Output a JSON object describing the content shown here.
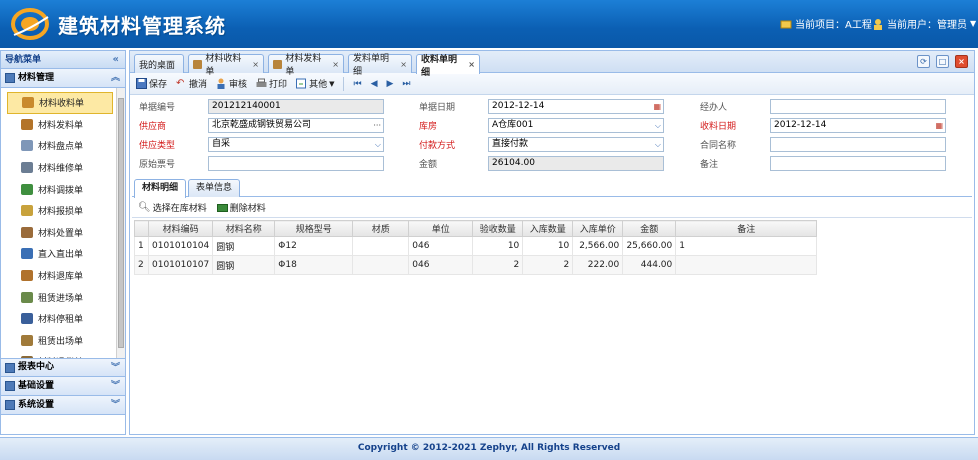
{
  "header": {
    "title": "建筑材料管理系统",
    "project": "当前项目：A工程",
    "user": "当前用户：管理员"
  },
  "sidebar": {
    "title": "导航菜单",
    "groups": [
      {
        "label": "材料管理"
      },
      {
        "label": "报表中心"
      },
      {
        "label": "基础设置"
      },
      {
        "label": "系统设置"
      }
    ],
    "items": [
      {
        "label": "材料收料单",
        "color": "#c98a2c"
      },
      {
        "label": "材料发料单",
        "color": "#b3742a"
      },
      {
        "label": "材料盘点单",
        "color": "#7f97b8"
      },
      {
        "label": "材料维修单",
        "color": "#6b7d93"
      },
      {
        "label": "材料调拨单",
        "color": "#3f8f3f"
      },
      {
        "label": "材料报损单",
        "color": "#c8a23c"
      },
      {
        "label": "材料处置单",
        "color": "#9a6b3a"
      },
      {
        "label": "直入直出单",
        "color": "#3a6fb5"
      },
      {
        "label": "材料退库单",
        "color": "#b0722c"
      },
      {
        "label": "租赁进场单",
        "color": "#6a8a4a"
      },
      {
        "label": "材料停租单",
        "color": "#3a5f9a"
      },
      {
        "label": "租赁出场单",
        "color": "#a07a3a"
      },
      {
        "label": "材料退货单",
        "color": "#8a6a3a"
      }
    ]
  },
  "tabs": [
    {
      "label": "我的桌面"
    },
    {
      "label": "材料收料单"
    },
    {
      "label": "材料发料单"
    },
    {
      "label": "发料单明细"
    },
    {
      "label": "收料单明细"
    }
  ],
  "toolbar": {
    "save": "保存",
    "undo": "撤消",
    "audit": "审核",
    "print": "打印",
    "other": "其他"
  },
  "form": {
    "doc_no_label": "单据编号",
    "doc_no": "201212140001",
    "doc_date_label": "单据日期",
    "doc_date": "2012-12-14",
    "handler_label": "经办人",
    "handler": "",
    "supplier_label": "供应商",
    "supplier": "北京乾盛成钢铁贸易公司",
    "warehouse_label": "库房",
    "warehouse": "A仓库001",
    "recv_date_label": "收料日期",
    "recv_date": "2012-12-14",
    "supply_type_label": "供应类型",
    "supply_type": "自采",
    "pay_label": "付款方式",
    "pay": "直接付款",
    "contract_label": "合同名称",
    "contract": "",
    "orig_no_label": "原始票号",
    "orig_no": "",
    "amount_label": "金额",
    "amount": "26104.00",
    "remark_label": "备注",
    "remark": ""
  },
  "subtabs": [
    {
      "label": "材料明细"
    },
    {
      "label": "表单信息"
    }
  ],
  "grid_tools": {
    "select": "选择在库材料",
    "delete": "删除材料"
  },
  "grid": {
    "columns": [
      "材料编码",
      "材料名称",
      "规格型号",
      "材质",
      "单位",
      "验收数量",
      "入库数量",
      "入库单价",
      "金额",
      "备注"
    ],
    "rows": [
      {
        "no": "1",
        "code": "0101010104",
        "name": "圆钢",
        "spec": "Φ12",
        "material": "",
        "unit": "046",
        "check_qty": "10",
        "in_qty": "10",
        "price": "2,566.00",
        "amount": "25,660.00",
        "remark": "1"
      },
      {
        "no": "2",
        "code": "0101010107",
        "name": "圆钢",
        "spec": "Φ18",
        "material": "",
        "unit": "046",
        "check_qty": "2",
        "in_qty": "2",
        "price": "222.00",
        "amount": "444.00",
        "remark": ""
      }
    ]
  },
  "footer": "Copyright © 2012-2021 Zephyr, All Rights Reserved"
}
